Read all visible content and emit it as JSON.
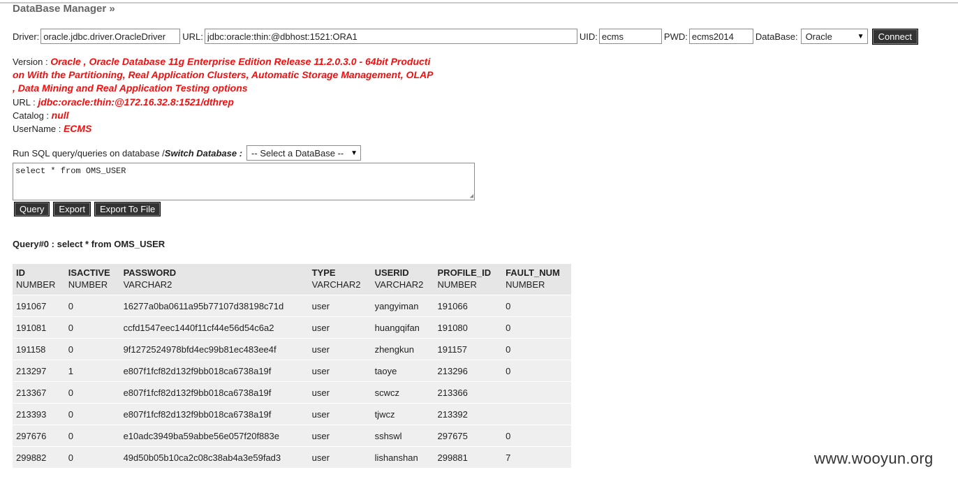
{
  "app": {
    "title": "DataBase Manager »"
  },
  "connection": {
    "driver_label": "Driver:",
    "driver_value": "oracle.jdbc.driver.OracleDriver",
    "url_label": "URL:",
    "url_value": "jdbc:oracle:thin:@dbhost:1521:ORA1",
    "uid_label": "UID:",
    "uid_value": "ecms",
    "pwd_label": "PWD:",
    "pwd_value": "ecms2014",
    "db_label": "DataBase:",
    "db_selected": "Oracle",
    "connect_label": "Connect"
  },
  "info": {
    "version_label": "Version : ",
    "version_line1": "Oracle , Oracle Database 11g Enterprise Edition Release 11.2.0.3.0 - 64bit Producti",
    "version_line2": "on With the Partitioning, Real Application Clusters, Automatic Storage Management, OLAP",
    "version_line3": ", Data Mining and Real Application Testing options",
    "url_label": "URL : ",
    "url_value": "jdbc:oracle:thin:@172.16.32.8:1521/dthrep",
    "catalog_label": "Catalog : ",
    "catalog_value": "null",
    "username_label": "UserName : ",
    "username_value": "ECMS"
  },
  "run": {
    "label": "Run SQL query/queries on database / ",
    "switch_label": "Switch Database :",
    "switch_selected": "-- Select a DataBase --",
    "sql_text": "select * from OMS_USER",
    "query_button": "Query",
    "export_button": "Export",
    "export_file_button": "Export To File"
  },
  "result": {
    "title": "Query#0 : select * from OMS_USER",
    "columns": [
      {
        "name": "ID",
        "type": "NUMBER"
      },
      {
        "name": "ISACTIVE",
        "type": "NUMBER"
      },
      {
        "name": "PASSWORD",
        "type": "VARCHAR2"
      },
      {
        "name": "TYPE",
        "type": "VARCHAR2"
      },
      {
        "name": "USERID",
        "type": "VARCHAR2"
      },
      {
        "name": "PROFILE_ID",
        "type": "NUMBER"
      },
      {
        "name": "FAULT_NUM",
        "type": "NUMBER"
      }
    ],
    "rows": [
      [
        "191067",
        "0",
        "16277a0ba0611a95b77107d38198c71d",
        "user",
        "yangyiman",
        "191066",
        "0"
      ],
      [
        "191081",
        "0",
        "ccfd1547eec1440f11cf44e56d54c6a2",
        "user",
        "huangqifan",
        "191080",
        "0"
      ],
      [
        "191158",
        "0",
        "9f1272524978bfd4ec99b81ec483ee4f",
        "user",
        "zhengkun",
        "191157",
        "0"
      ],
      [
        "213297",
        "1",
        "e807f1fcf82d132f9bb018ca6738a19f",
        "user",
        "taoye",
        "213296",
        "0"
      ],
      [
        "213367",
        "0",
        "e807f1fcf82d132f9bb018ca6738a19f",
        "user",
        "scwcz",
        "213366",
        ""
      ],
      [
        "213393",
        "0",
        "e807f1fcf82d132f9bb018ca6738a19f",
        "user",
        "tjwcz",
        "213392",
        ""
      ],
      [
        "297676",
        "0",
        "e10adc3949ba59abbe56e057f20f883e",
        "user",
        "sshswl",
        "297675",
        "0"
      ],
      [
        "299882",
        "0",
        "49d50b05b10ca2c08c38ab4a3e59fad3",
        "user",
        "lishanshan",
        "299881",
        "7"
      ]
    ]
  },
  "watermark": "www.wooyun.org"
}
